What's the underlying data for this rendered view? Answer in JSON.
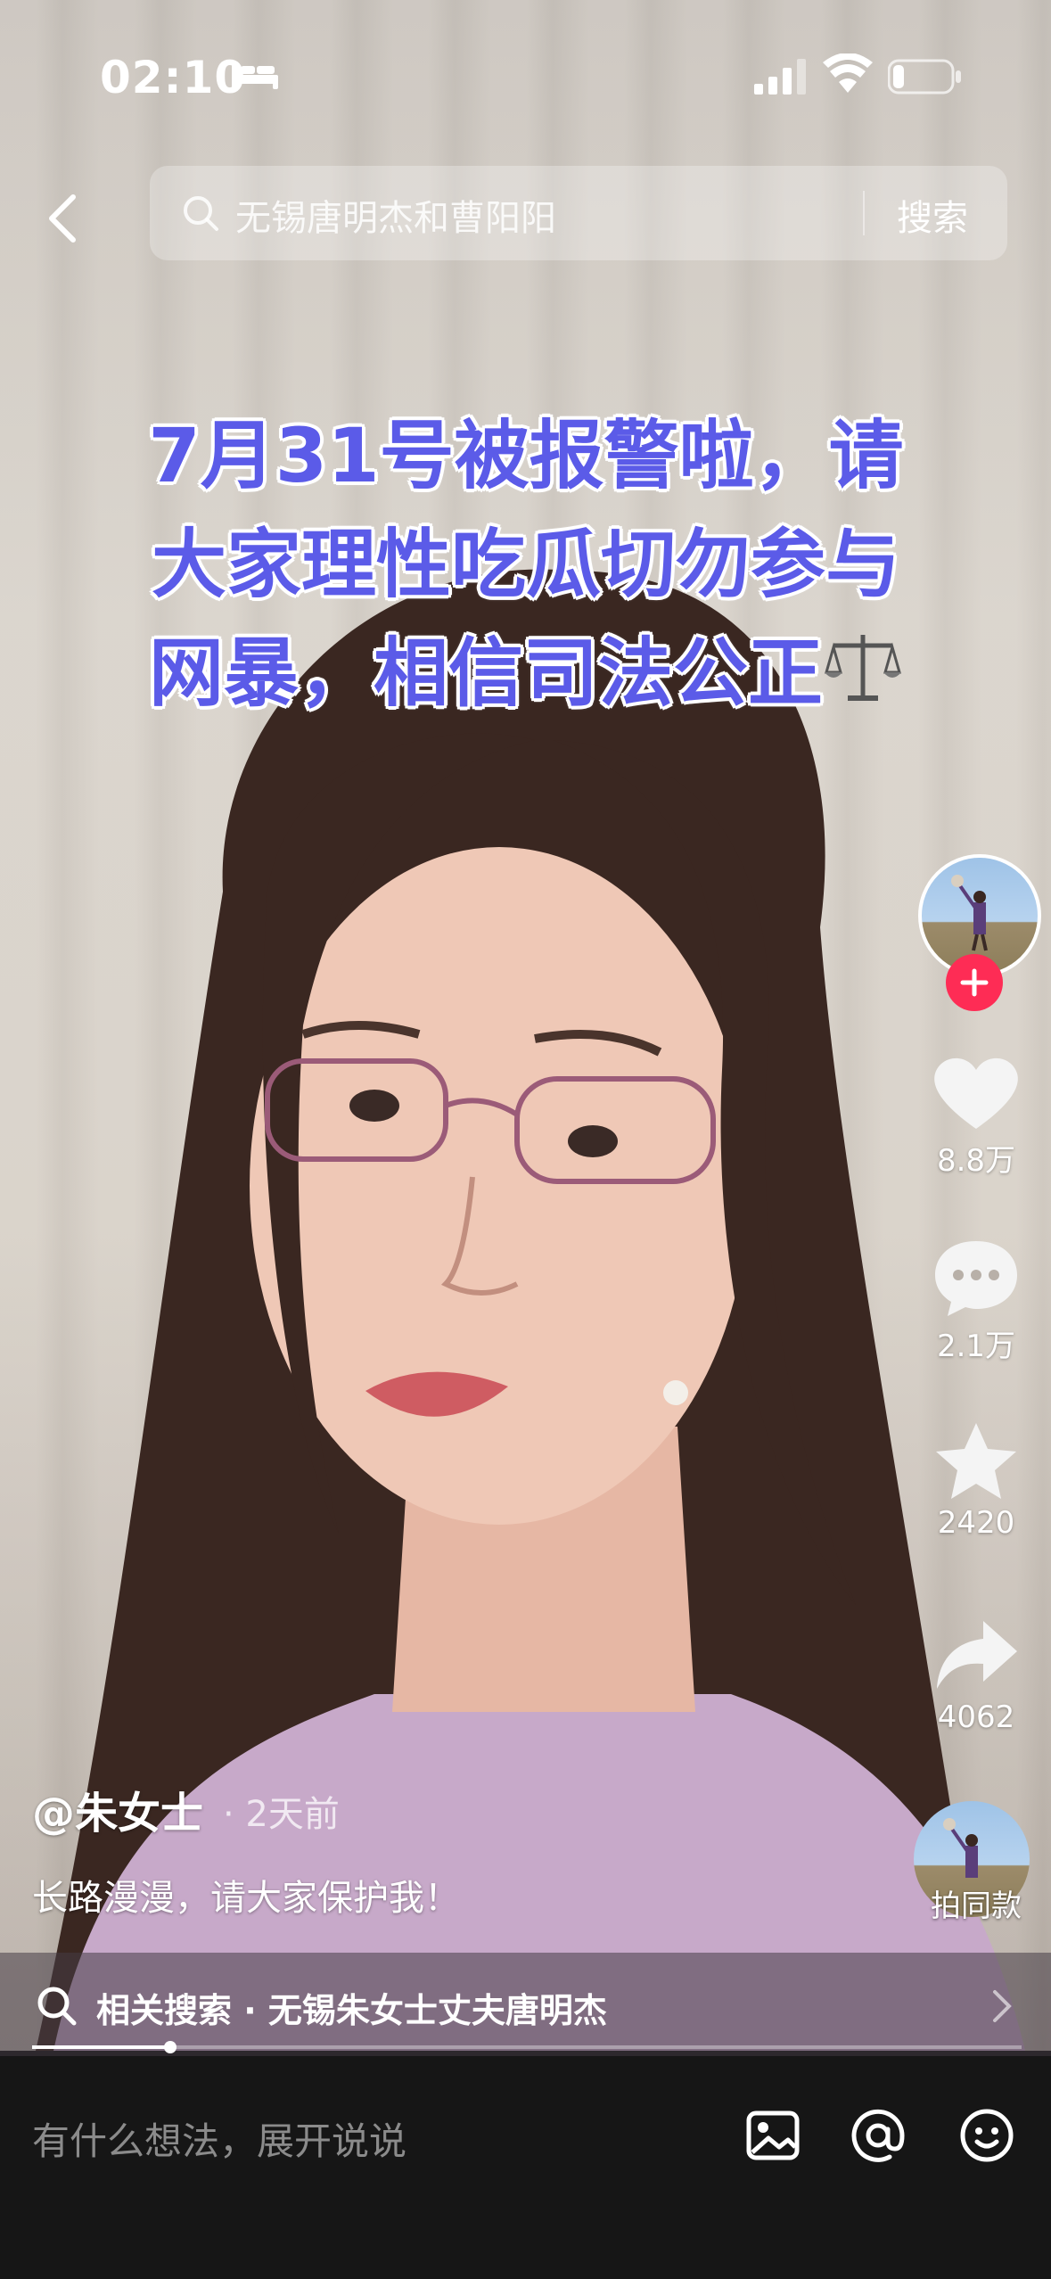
{
  "status_bar": {
    "time": "02:10",
    "icons": [
      "bed-icon",
      "signal-icon",
      "wifi-icon",
      "battery-icon"
    ],
    "battery_level": 0.15
  },
  "search": {
    "query": "无锡唐明杰和曹阳阳",
    "button_label": "搜索"
  },
  "video": {
    "caption_line1": "7月31号被报警啦，请",
    "caption_line2": "大家理性吃瓜切勿参与",
    "caption_line3": "网暴，相信司法公正",
    "caption_color": "#5b5be8"
  },
  "actions": {
    "likes": "8.8万",
    "comments": "2.1万",
    "favorites": "2420",
    "shares": "4062",
    "music_label": "拍同款",
    "follow_color": "#fe2c55"
  },
  "post": {
    "author": "@朱女士",
    "time_ago": "· 2天前",
    "description": "长路漫漫，请大家保护我！"
  },
  "related_search": {
    "text": "相关搜索 · 无锡朱女士丈夫唐明杰"
  },
  "playback": {
    "progress": 0.14
  },
  "comment_bar": {
    "placeholder": "有什么想法，展开说说",
    "icons": [
      "image-icon",
      "at-icon",
      "emoji-icon"
    ]
  }
}
